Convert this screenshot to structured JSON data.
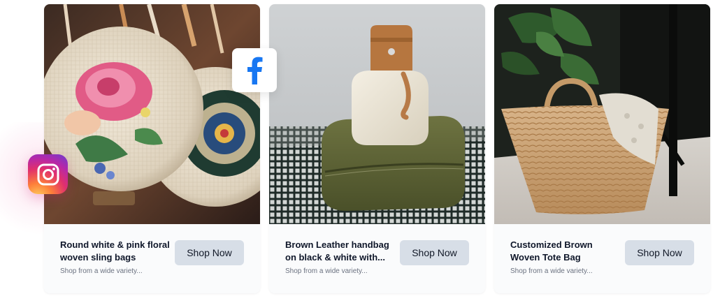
{
  "social": {
    "instagram_icon": "instagram-icon",
    "facebook_icon": "facebook-icon",
    "facebook_brand_color": "#1877f2"
  },
  "products": [
    {
      "title": "Round white & pink floral woven sling bags",
      "subtitle": "Shop from a wide variety...",
      "button_label": "Shop Now",
      "image": "product-photo-floral-sling-bags"
    },
    {
      "title": "Brown Leather handbag on black & white with...",
      "subtitle": "Shop from a wide variety...",
      "button_label": "Shop Now",
      "image": "product-photo-leather-handbag"
    },
    {
      "title": "Customized Brown Woven Tote Bag",
      "subtitle": "Shop from a wide variety...",
      "button_label": "Shop Now",
      "image": "product-photo-woven-tote-bag"
    }
  ],
  "colors": {
    "card_background": "#fafbfc",
    "button_background": "#d7dee7",
    "title_text": "#0f172a",
    "subtitle_text": "#6b7280"
  }
}
